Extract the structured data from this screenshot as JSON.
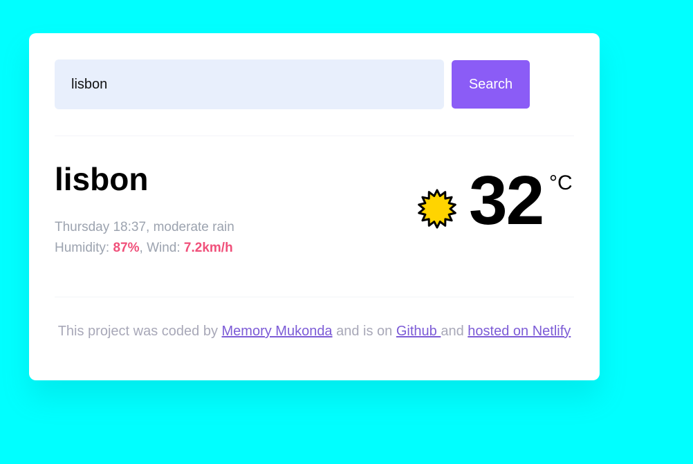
{
  "search": {
    "value": "lisbon",
    "button_label": "Search"
  },
  "weather": {
    "city": "lisbon",
    "datetime": "Thursday 18:37",
    "description": "moderate rain",
    "humidity_label": "Humidity: ",
    "humidity_value": "87%",
    "wind_label": "Wind: ",
    "wind_value": "7.2km/h",
    "temperature": "32",
    "unit": "°C",
    "icon": "sun-icon"
  },
  "footer": {
    "prefix": "This project was coded by ",
    "author_link": "Memory Mukonda",
    "middle1": " and is on ",
    "github_link": "Github ",
    "middle2": "and ",
    "netlify_link": "hosted on Netlify"
  },
  "colors": {
    "background": "#00ffff",
    "accent": "#8b5cf6",
    "highlight": "#f0507a",
    "input_bg": "#e8effc"
  }
}
